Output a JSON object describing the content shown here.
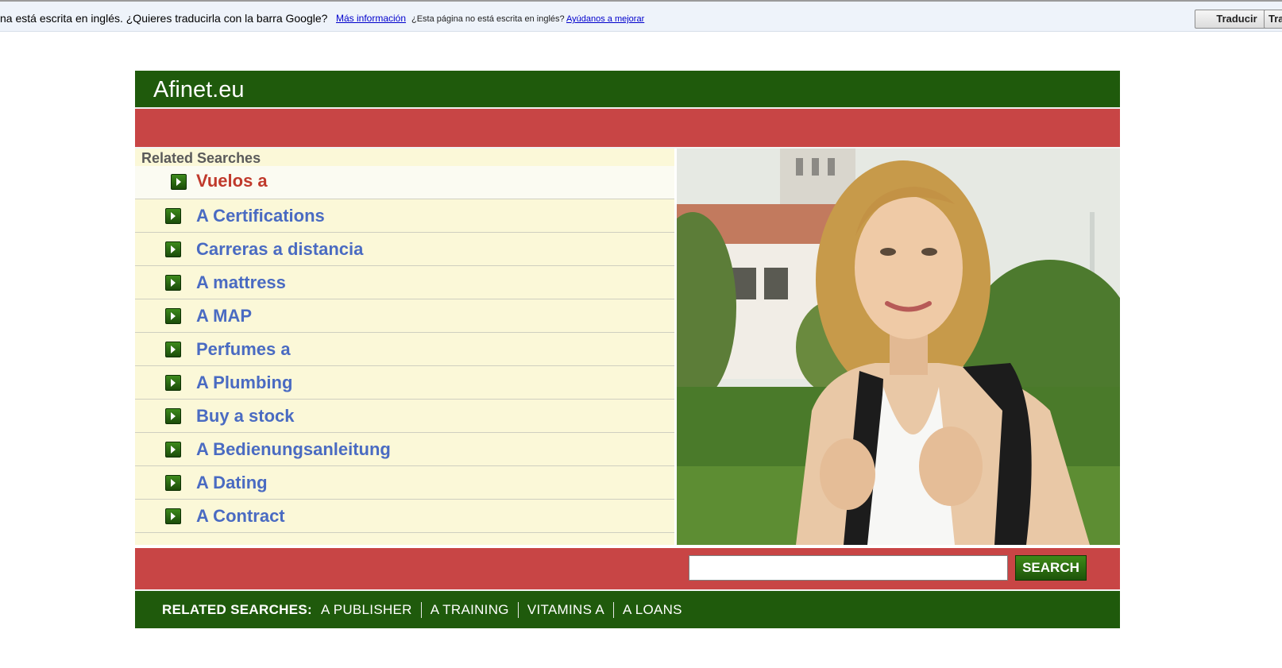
{
  "translate_bar": {
    "message": "na está escrita en inglés. ¿Quieres traducirla con la barra Google?",
    "more_info": "Más información",
    "not_english": "¿Esta página no está escrita en inglés?",
    "help_improve": "Ayúdanos a mejorar",
    "translate_button": "Traducir",
    "translate_button_2": "Trad"
  },
  "header": {
    "title": "Afinet.eu"
  },
  "related": {
    "title": "Related Searches",
    "items": [
      {
        "label": "Vuelos a"
      },
      {
        "label": "A Certifications"
      },
      {
        "label": "Carreras a distancia"
      },
      {
        "label": "A mattress"
      },
      {
        "label": "A MAP"
      },
      {
        "label": "Perfumes a"
      },
      {
        "label": "A Plumbing"
      },
      {
        "label": "Buy a stock"
      },
      {
        "label": "A Bedienungsanleitung"
      },
      {
        "label": "A Dating"
      },
      {
        "label": "A Contract"
      }
    ]
  },
  "search": {
    "value": "",
    "button_label": "SEARCH"
  },
  "footer": {
    "heading": "RELATED SEARCHES:",
    "links": [
      "A PUBLISHER",
      "A TRAINING",
      "VITAMINS A",
      "A LOANS"
    ]
  },
  "colors": {
    "green": "#1f5a0c",
    "red": "#c84545",
    "list_bg": "#fbf8d8",
    "link": "#4a6bc2",
    "active_link": "#c0392b"
  }
}
